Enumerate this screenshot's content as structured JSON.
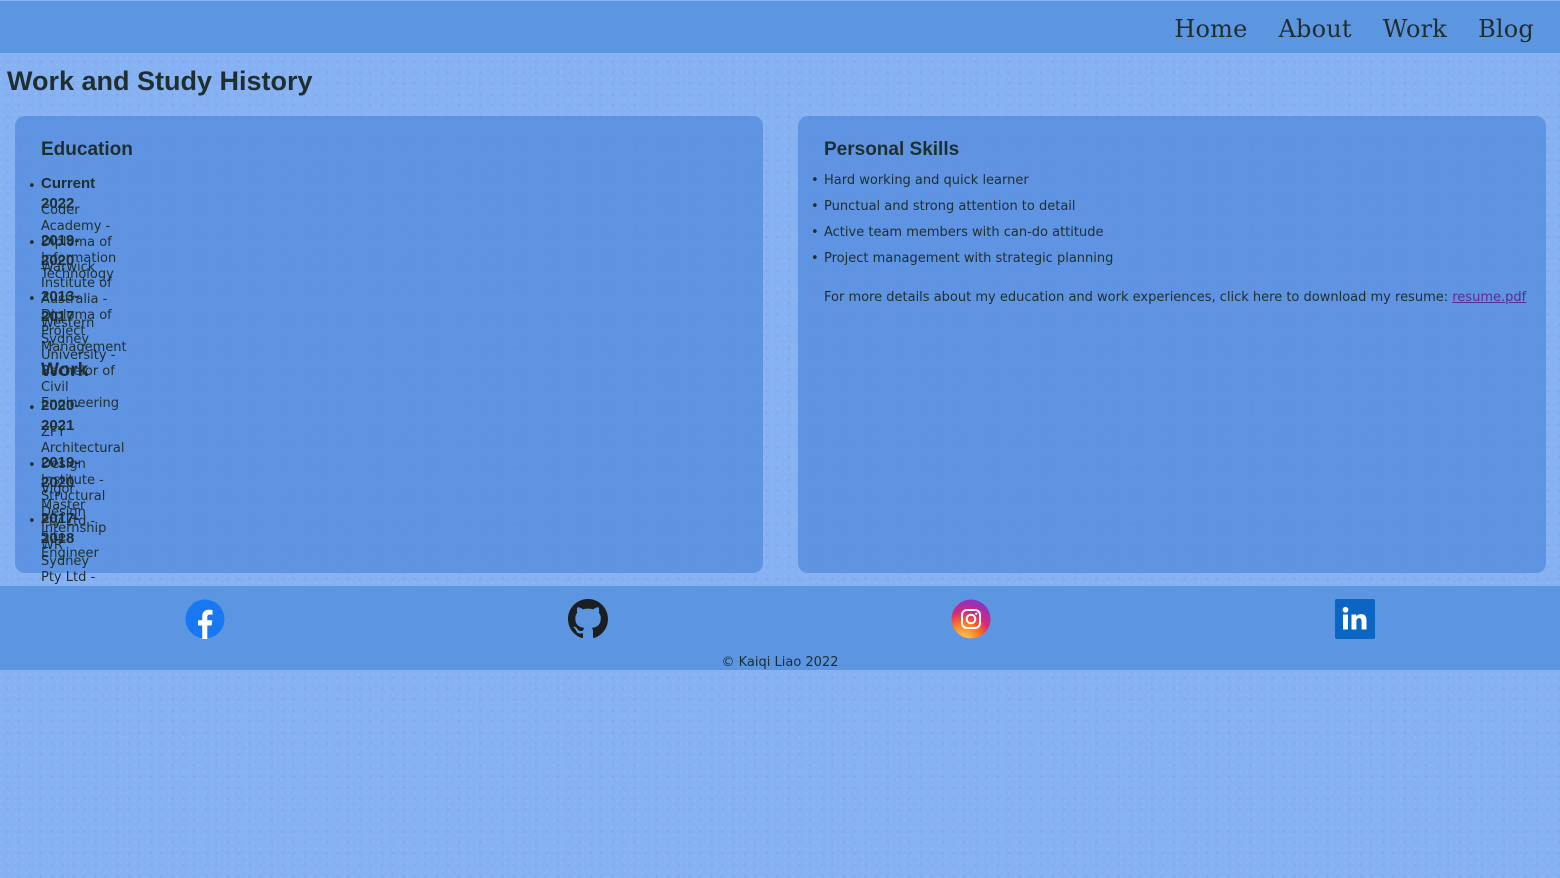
{
  "nav": {
    "items": [
      "Home",
      "About",
      "Work",
      "Blog"
    ]
  },
  "page_title": "Work and Study History",
  "education": {
    "heading": "Education",
    "items": [
      {
        "year": "Current 2022",
        "desc": "Coder Academy - Diploma of Information Technology"
      },
      {
        "year": "2019-2020",
        "desc": "Warwick Institute of Australia - Diploma of Project Management"
      },
      {
        "year": "2013-2017",
        "desc": "Western Sydney University - Bachelor of Civil Engineering"
      }
    ]
  },
  "work": {
    "heading": "Work",
    "items": [
      {
        "year": "2020-2021",
        "desc": "ZFY Architectural Design Institute - Structural Design Internship"
      },
      {
        "year": "2019-2020",
        "desc": "Vigor Master Pty Ltd -Site Engineer"
      },
      {
        "year": "2017-2018",
        "desc": "WR Sydney Pty Ltd -Site Engineer"
      }
    ]
  },
  "skills": {
    "heading": "Personal Skills",
    "items": [
      "Hard working and quick learner",
      "Punctual and strong attention to detail",
      "Active team members with can-do attitude",
      "Project management with strategic planning"
    ],
    "resume_text": "For more details about my education and work experiences, click here to download my resume: ",
    "resume_link": "resume.pdf"
  },
  "footer": {
    "social_icons": [
      "facebook-icon",
      "github-icon",
      "instagram-icon",
      "linkedin-icon"
    ],
    "copyright": "© Kaiqi Liao 2022"
  },
  "colors": {
    "background": "#86b1f3",
    "navbar": "#5d96e0",
    "card": "#558cdc",
    "text": "#1f2f2f",
    "link": "#5b2b8f"
  }
}
